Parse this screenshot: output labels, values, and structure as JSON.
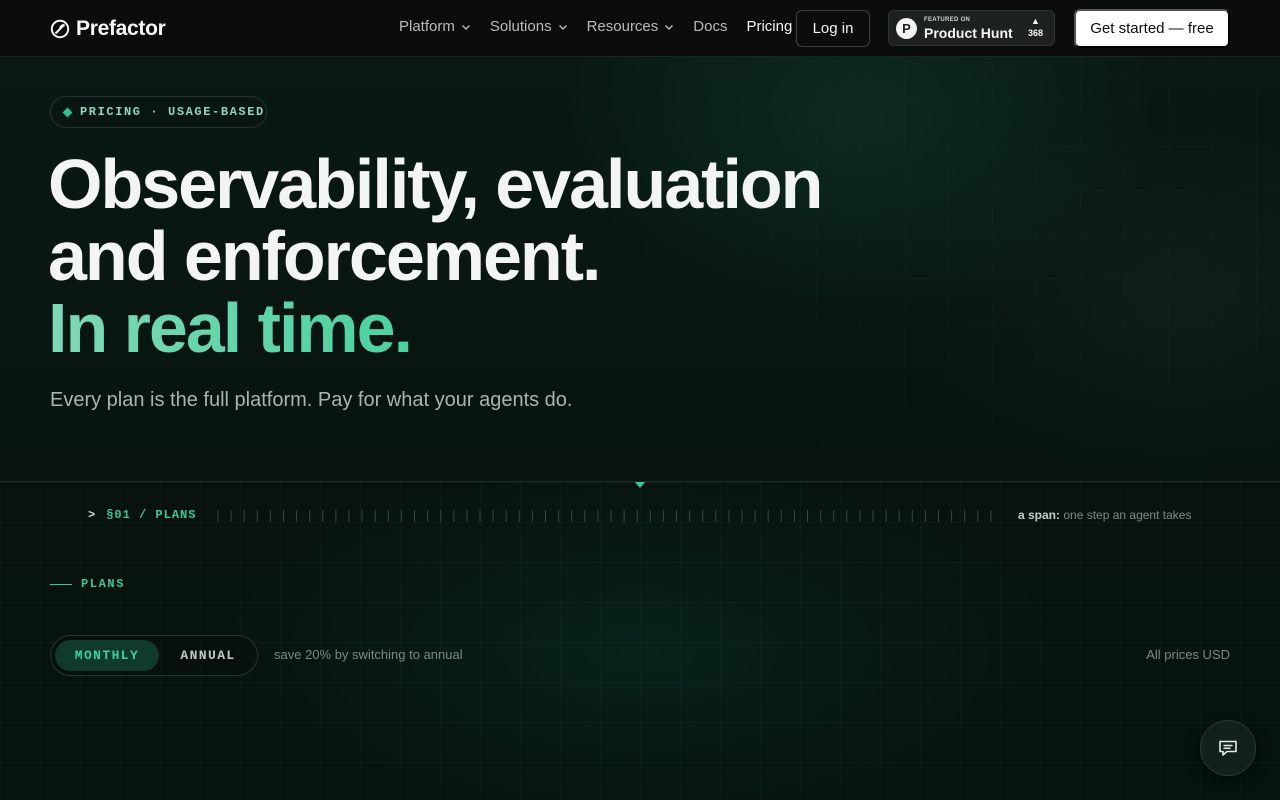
{
  "brand": {
    "name": "Prefactor"
  },
  "nav": {
    "items": [
      {
        "label": "Platform",
        "dropdown": true
      },
      {
        "label": "Solutions",
        "dropdown": true
      },
      {
        "label": "Resources",
        "dropdown": true
      },
      {
        "label": "Docs",
        "dropdown": false
      },
      {
        "label": "Pricing",
        "dropdown": false
      }
    ],
    "login_label": "Log in",
    "product_hunt": {
      "small": "FEATURED ON",
      "big": "Product Hunt",
      "votes": "368",
      "logo_letter": "P"
    },
    "cta_label": "Get started — free"
  },
  "hero": {
    "badge": "PRICING · USAGE-BASED",
    "title_line1": "Observability, evaluation",
    "title_line2": "and enforcement.",
    "title_line3": "In real time.",
    "subtitle": "Every plan is the full platform. Pay for what your agents do."
  },
  "section": {
    "prompt": ">",
    "label": "§01 / PLANS",
    "span_key": "a span:",
    "span_value": "one step an agent takes"
  },
  "plans": {
    "label": "PLANS",
    "toggle": {
      "monthly": "MONTHLY",
      "annual": "ANNUAL",
      "selected": "monthly"
    },
    "save_note": "save 20% by switching to annual",
    "currency_note": "All prices USD"
  },
  "colors": {
    "accent": "#3ec698",
    "background": "#07110e",
    "cta_bg": "#ffffff"
  },
  "icons": {
    "chat": "chat-icon",
    "logo": "prefactor-logo-icon"
  }
}
